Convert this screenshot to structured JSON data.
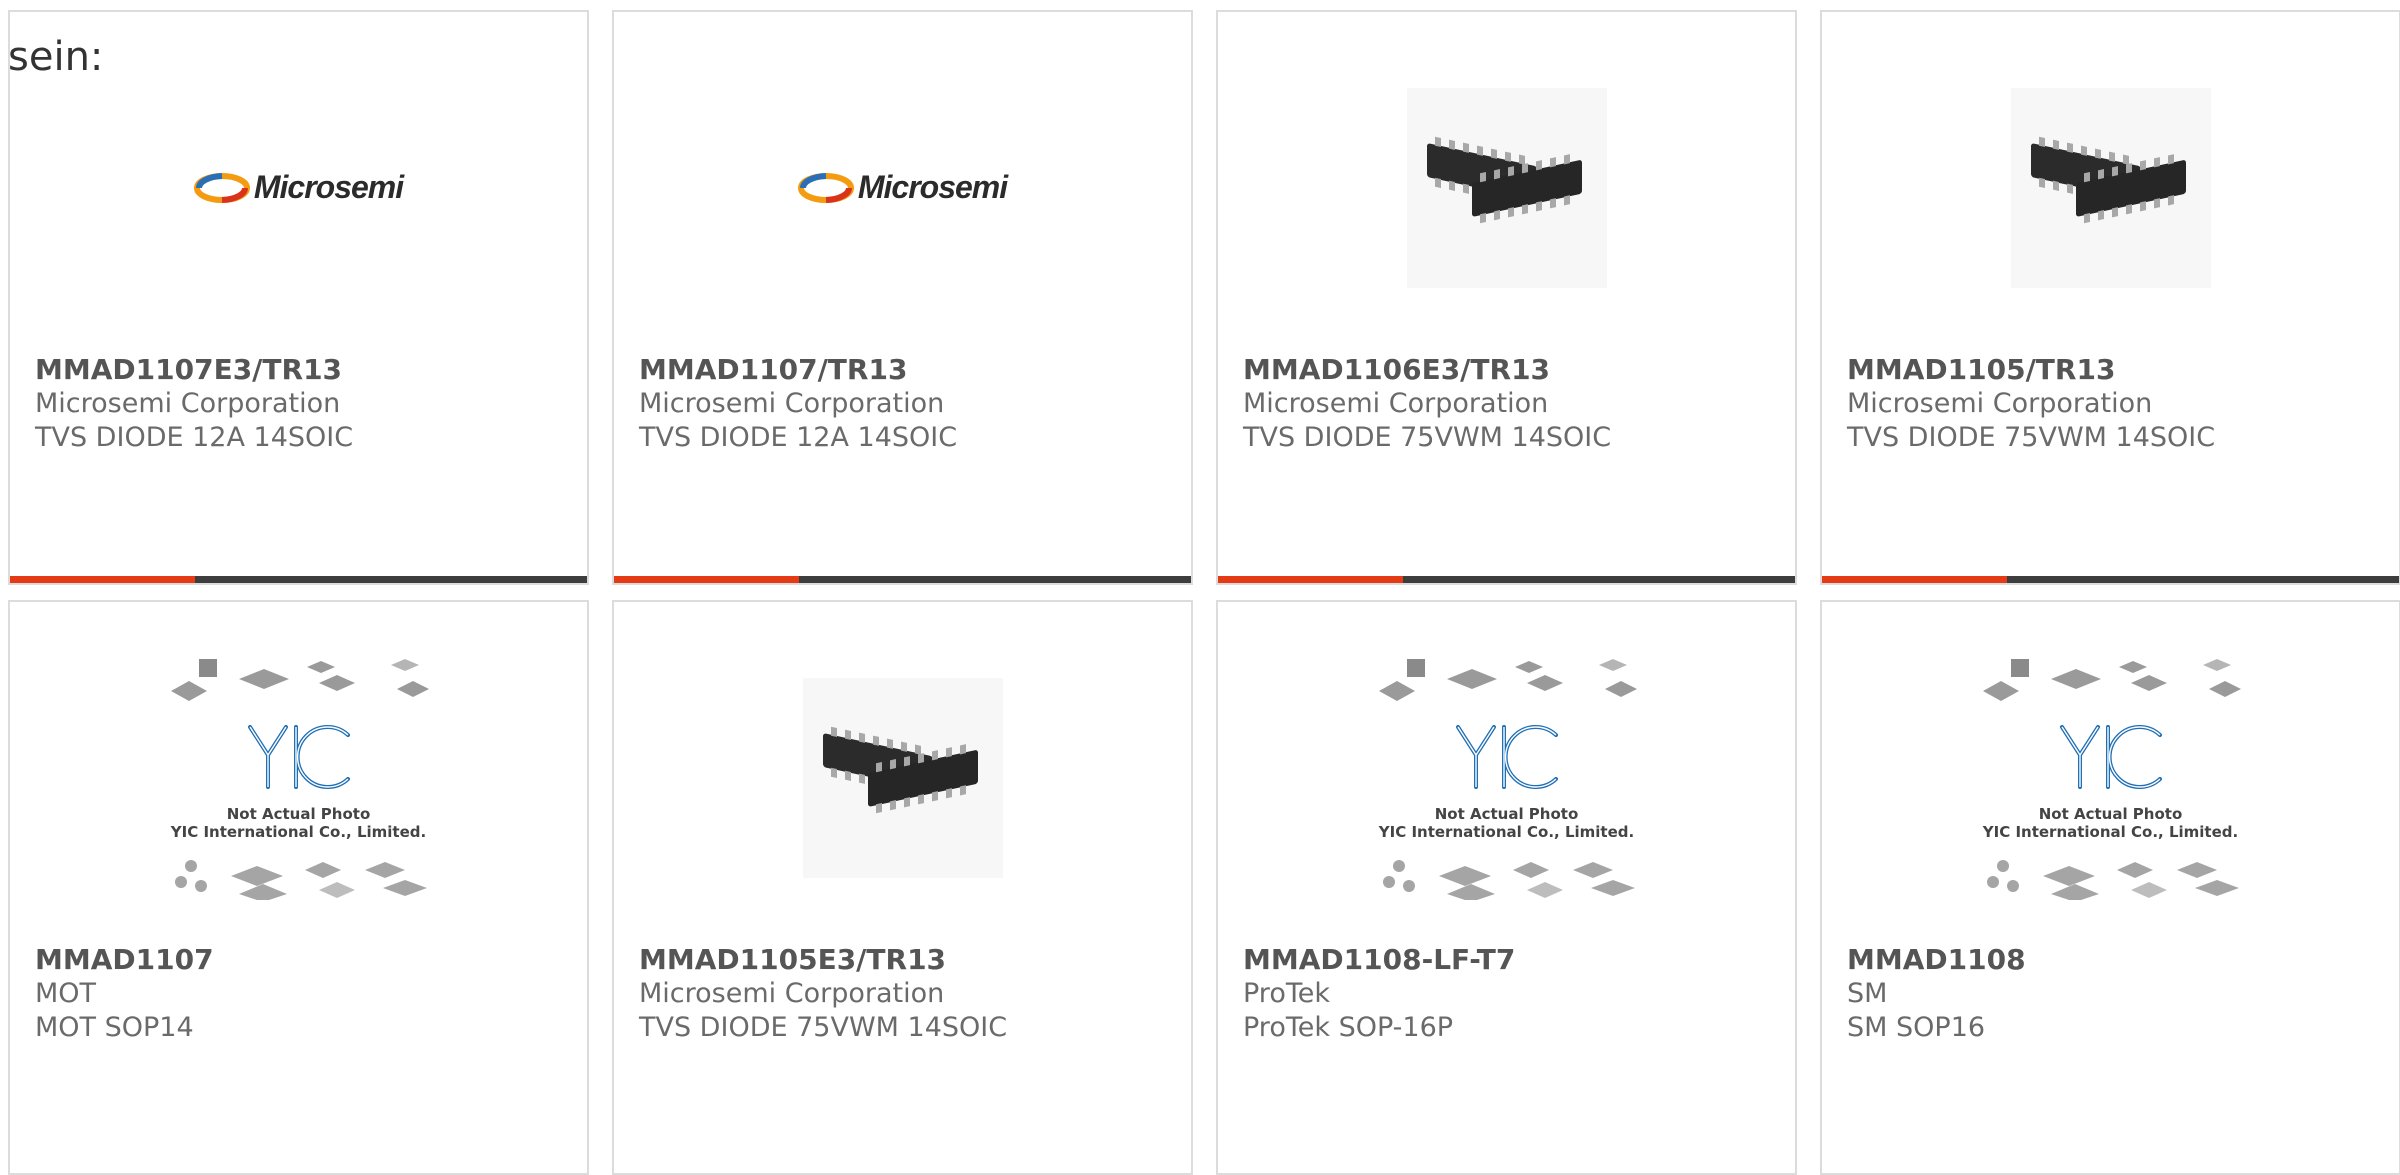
{
  "heading": "sein:",
  "colors": {
    "accent": "#e43a15",
    "bar": "#3d3d3d",
    "border": "#dcdcdc",
    "part_number": "#555555",
    "text": "#6a6a6a",
    "yic_blue": "#1f6fb5"
  },
  "products": [
    {
      "part_number": "MMAD1107E3/TR13",
      "manufacturer": "Microsemi Corporation",
      "description": "TVS DIODE 12A 14SOIC",
      "image": "microsemi-logo",
      "logo_text": "Microsemi"
    },
    {
      "part_number": "MMAD1107/TR13",
      "manufacturer": "Microsemi Corporation",
      "description": "TVS DIODE 12A 14SOIC",
      "image": "microsemi-logo",
      "logo_text": "Microsemi"
    },
    {
      "part_number": "MMAD1106E3/TR13",
      "manufacturer": "Microsemi Corporation",
      "description": "TVS DIODE 75VWM 14SOIC",
      "image": "soic-chip-photo"
    },
    {
      "part_number": "MMAD1105/TR13",
      "manufacturer": "Microsemi Corporation",
      "description": "TVS DIODE 75VWM 14SOIC",
      "image": "soic-chip-photo"
    },
    {
      "part_number": "MMAD1107",
      "manufacturer": "MOT",
      "description": "MOT SOP14",
      "image": "yic-placeholder",
      "caption_line1": "Not Actual Photo",
      "caption_line2": "YIC International Co., Limited."
    },
    {
      "part_number": "MMAD1105E3/TR13",
      "manufacturer": "Microsemi Corporation",
      "description": "TVS DIODE 75VWM 14SOIC",
      "image": "soic-chip-photo"
    },
    {
      "part_number": "MMAD1108-LF-T7",
      "manufacturer": "ProTek",
      "description": "ProTek SOP-16P",
      "image": "yic-placeholder",
      "caption_line1": "Not Actual Photo",
      "caption_line2": "YIC International Co., Limited."
    },
    {
      "part_number": "MMAD1108",
      "manufacturer": "SM",
      "description": "SM SOP16",
      "image": "yic-placeholder",
      "caption_line1": "Not Actual Photo",
      "caption_line2": "YIC International Co., Limited."
    }
  ]
}
